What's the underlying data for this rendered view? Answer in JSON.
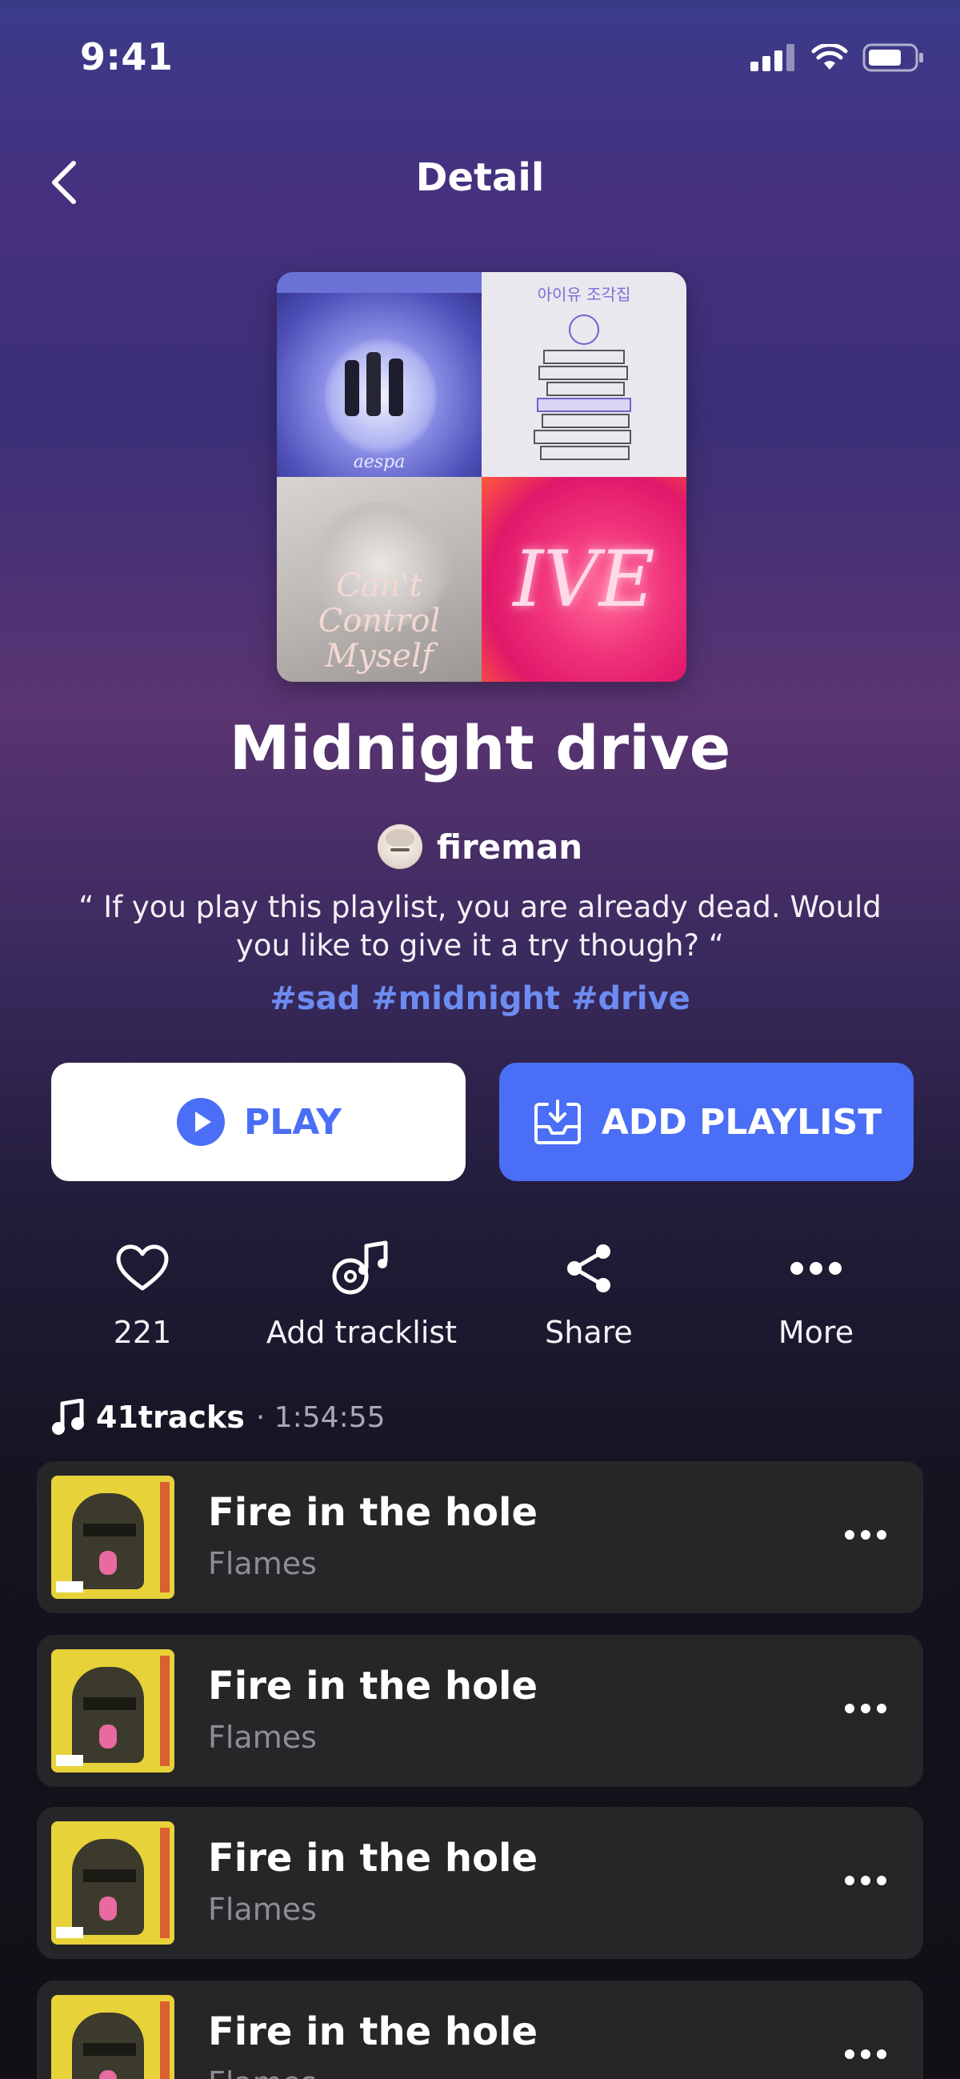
{
  "status": {
    "time": "9:41"
  },
  "nav": {
    "title": "Detail"
  },
  "cover": {
    "tile1_text": "aespa",
    "tile2_text": "아이유 조각집",
    "tile3_text": "Can't Control Myself",
    "tile4_text": "IVE"
  },
  "playlist": {
    "name": "Midnight drive",
    "owner": "fireman",
    "description": "“ If you play this playlist, you are already dead. Would you like to give it a try though? “",
    "tags": "#sad #midnight #drive"
  },
  "buttons": {
    "play": "PLAY",
    "add_playlist": "ADD PLAYLIST"
  },
  "actions": [
    {
      "icon": "heart-icon",
      "label": "221"
    },
    {
      "icon": "tracklist-icon",
      "label": "Add tracklist"
    },
    {
      "icon": "share-icon",
      "label": "Share"
    },
    {
      "icon": "more-icon",
      "label": "More"
    }
  ],
  "tracks_header": {
    "count": "41tracks",
    "duration": "· 1:54:55"
  },
  "tracks": [
    {
      "title": "Fire in the hole",
      "artist": "Flames"
    },
    {
      "title": "Fire in the hole",
      "artist": "Flames"
    },
    {
      "title": "Fire in the hole",
      "artist": "Flames"
    },
    {
      "title": "Fire in the hole",
      "artist": "Flames"
    }
  ],
  "colors": {
    "accent": "#4a6ef5",
    "tag": "#6d8cf2",
    "card": "#262628"
  }
}
